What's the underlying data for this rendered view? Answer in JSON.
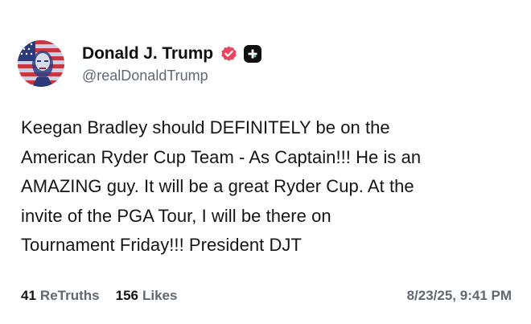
{
  "author": {
    "display_name": "Donald J. Trump",
    "handle": "@realDonaldTrump",
    "avatar_icon": "flag-portrait-avatar",
    "verified_icon": "verified-badge-icon",
    "verified_color": "#e8455e",
    "plus_icon": "plus-badge-icon"
  },
  "post": {
    "lines": [
      "Keegan Bradley should DEFINITELY be on the",
      "American Ryder Cup Team - As Captain!!! He is an",
      "AMAZING guy. It will be a great Ryder Cup. At the",
      "invite of the PGA Tour, I will be there on",
      "Tournament Friday!!! President DJT"
    ]
  },
  "stats": {
    "retruths_count": "41",
    "retruths_label": "ReTruths",
    "likes_count": "156",
    "likes_label": "Likes",
    "timestamp": "8/23/25, 9:41 PM"
  }
}
